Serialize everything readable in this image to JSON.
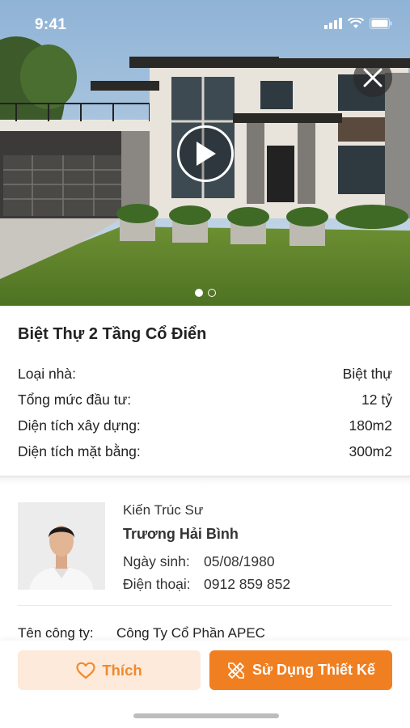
{
  "status_bar": {
    "time": "9:41"
  },
  "gallery": {
    "active_index": 0,
    "total": 2
  },
  "info": {
    "title": "Biệt Thự 2 Tầng Cổ Điển",
    "rows": [
      {
        "label": "Loại nhà:",
        "value": "Biệt thự"
      },
      {
        "label": "Tổng mức đầu tư:",
        "value": "12 tỷ"
      },
      {
        "label": "Diện tích xây dựng:",
        "value": "180m2"
      },
      {
        "label": "Diện tích mặt bằng:",
        "value": "300m2"
      }
    ]
  },
  "architect": {
    "role": "Kiến Trúc Sư",
    "name": "Trương Hải Bình",
    "dob_label": "Ngày sinh:",
    "dob_value": "05/08/1980",
    "phone_label": "Điện thoại:",
    "phone_value": "0912 859 852"
  },
  "company": {
    "label": "Tên công ty:",
    "value": "Công Ty Cổ Phần APEC"
  },
  "footer": {
    "like_label": "Thích",
    "use_label": "Sử Dụng Thiết Kế"
  },
  "colors": {
    "accent": "#f07f22",
    "accent_light": "#fdeadb"
  }
}
